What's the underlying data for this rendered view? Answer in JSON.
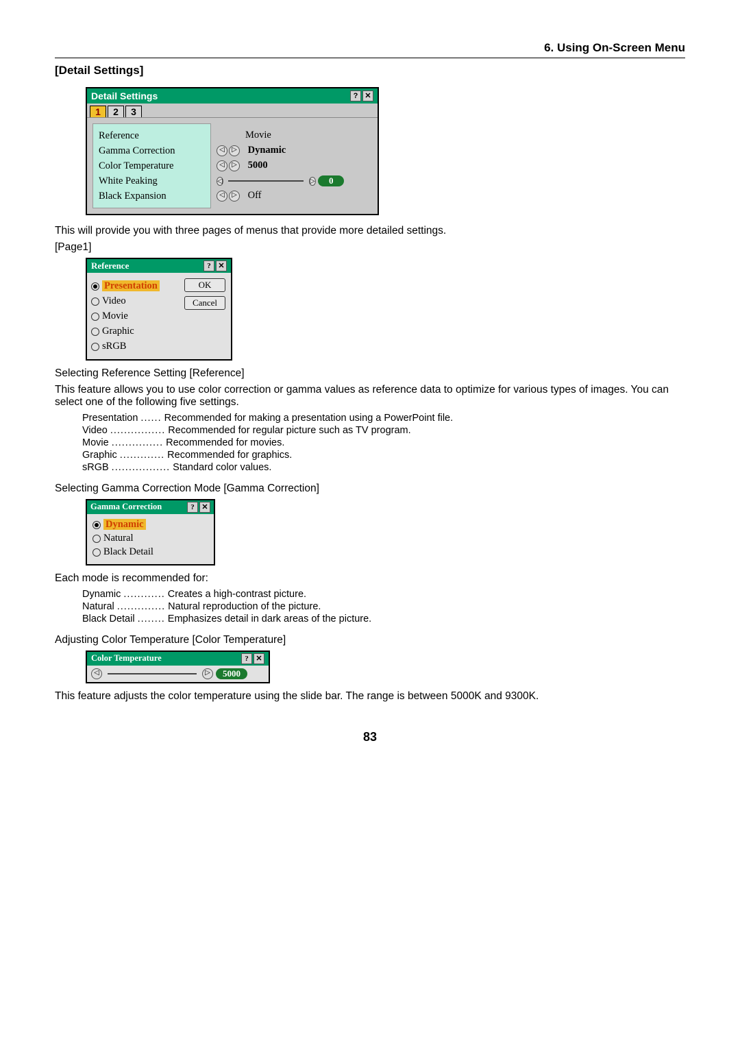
{
  "header": "6. Using On-Screen Menu",
  "section_title": "[Detail Settings]",
  "detail_dialog": {
    "title": "Detail Settings",
    "tabs": [
      "1",
      "2",
      "3"
    ],
    "rows": [
      {
        "label": "Reference",
        "value": "Movie"
      },
      {
        "label": "Gamma Correction",
        "value": "Dynamic"
      },
      {
        "label": "Color Temperature",
        "value": "5000"
      },
      {
        "label": "White Peaking",
        "value": "0"
      },
      {
        "label": "Black Expansion",
        "value": "Off"
      }
    ]
  },
  "intro": "This will provide you with three pages of menus that provide more detailed settings.",
  "page1_label": "[Page1]",
  "ref_dialog": {
    "title": "Reference",
    "options": [
      "Presentation",
      "Video",
      "Movie",
      "Graphic",
      "sRGB"
    ],
    "ok": "OK",
    "cancel": "Cancel"
  },
  "ref_heading": "Selecting Reference Setting [Reference]",
  "ref_desc": "This feature allows you to use color correction or gamma values as reference data to optimize for various types of images. You can select one of the following five settings.",
  "ref_items": [
    {
      "term": "Presentation",
      "dots": "......",
      "def": "Recommended for making a presentation using a PowerPoint file."
    },
    {
      "term": "Video",
      "dots": "................",
      "def": "Recommended for regular picture such as TV program."
    },
    {
      "term": "Movie",
      "dots": "...............",
      "def": "Recommended for movies."
    },
    {
      "term": "Graphic",
      "dots": ".............",
      "def": "Recommended for graphics."
    },
    {
      "term": "sRGB",
      "dots": ".................",
      "def": "Standard color values."
    }
  ],
  "gamma_heading": "Selecting Gamma Correction Mode [Gamma Correction]",
  "gamma_dialog": {
    "title": "Gamma Correction",
    "options": [
      "Dynamic",
      "Natural",
      "Black Detail"
    ]
  },
  "gamma_lead": "Each mode is recommended for:",
  "gamma_items": [
    {
      "term": "Dynamic",
      "dots": "............",
      "def": "Creates a high-contrast picture."
    },
    {
      "term": "Natural",
      "dots": "..............",
      "def": "Natural reproduction of the picture."
    },
    {
      "term": "Black Detail",
      "dots": "........",
      "def": "Emphasizes detail in dark areas of the picture."
    }
  ],
  "ct_heading": "Adjusting Color Temperature [Color Temperature]",
  "ct_dialog": {
    "title": "Color Temperature",
    "value": "5000"
  },
  "ct_desc": "This feature adjusts the color temperature using the slide bar. The range is between 5000K and 9300K.",
  "page_num": "83"
}
